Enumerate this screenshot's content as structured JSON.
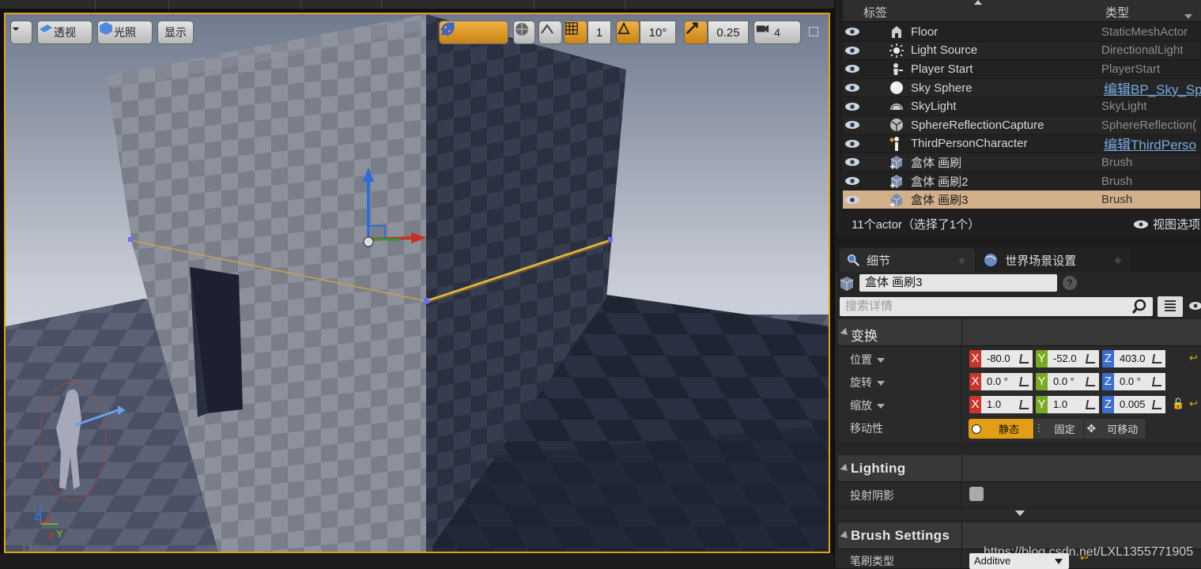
{
  "viewport": {
    "toolbar_left": {
      "dropdown_icon": "chevron-down-icon",
      "perspective_label": "透视",
      "lit_label": "光照",
      "show_label": "显示"
    },
    "toolbar_right": {
      "grid_snap_value": "1",
      "rotation_snap_value": "10°",
      "scale_snap_value": "0.25",
      "camera_speed_value": "4"
    },
    "axis_labels": {
      "z": "Z",
      "y": "Y",
      "x": "X"
    },
    "help_glyph": "?",
    "accent_color": "#e0a21a"
  },
  "outliner": {
    "col_label": "标签",
    "col_type": "类型",
    "rows": [
      {
        "name": "Floor",
        "type": "StaticMeshActor",
        "icon": "static-mesh-icon",
        "link": false
      },
      {
        "name": "Light Source",
        "type": "DirectionalLight",
        "icon": "sun-icon",
        "link": false
      },
      {
        "name": "Player Start",
        "type": "PlayerStart",
        "icon": "player-start-icon",
        "link": false
      },
      {
        "name": "Sky Sphere",
        "type": "编辑BP_Sky_Sp",
        "icon": "sphere-icon",
        "link": true
      },
      {
        "name": "SkyLight",
        "type": "SkyLight",
        "icon": "skylight-icon",
        "link": false
      },
      {
        "name": "SphereReflectionCapture",
        "type": "SphereReflection(",
        "icon": "reflection-capture-icon",
        "link": false
      },
      {
        "name": "ThirdPersonCharacter",
        "type": "编辑ThirdPerso",
        "icon": "character-icon",
        "link": true
      },
      {
        "name": "盒体 画刷",
        "type": "Brush",
        "icon": "brush-icon",
        "link": false
      },
      {
        "name": "盒体 画刷2",
        "type": "Brush",
        "icon": "brush-icon",
        "link": false
      },
      {
        "name": "盒体 画刷3",
        "type": "Brush",
        "icon": "brush-icon",
        "link": false,
        "selected": true
      }
    ],
    "count_text": "11个actor（选择了1个）",
    "view_options_label": "视图选项"
  },
  "details": {
    "tabs": [
      {
        "label": "细节",
        "icon": "magnifier-icon"
      },
      {
        "label": "世界场景设置",
        "icon": "globe-icon"
      }
    ],
    "actor_name": "盒体 画刷3",
    "search_placeholder": "搜索详情",
    "sections": {
      "transform": "变换",
      "lighting": "Lighting",
      "brush_settings": "Brush Settings"
    },
    "transform": {
      "location_label": "位置",
      "rotation_label": "旋转",
      "scale_label": "缩放",
      "mobility_label": "移动性",
      "location": {
        "x": "-80.0",
        "y": "-52.0",
        "z": "403.0"
      },
      "rotation": {
        "x": "0.0 °",
        "y": "0.0 °",
        "z": "0.0 °"
      },
      "scale": {
        "x": "1.0",
        "y": "1.0",
        "z": "0.005"
      },
      "axis_x": "X",
      "axis_y": "Y",
      "axis_z": "Z",
      "mobility_static": "静态",
      "mobility_stationary": "固定",
      "mobility_movable": "可移动"
    },
    "lighting": {
      "cast_shadow_label": "投射阴影",
      "cast_shadow": false
    },
    "brush": {
      "brush_type_label": "笔刷类型",
      "brush_type_value": "Additive"
    }
  },
  "watermark": "https://blog.csdn.net/LXL1355771905"
}
